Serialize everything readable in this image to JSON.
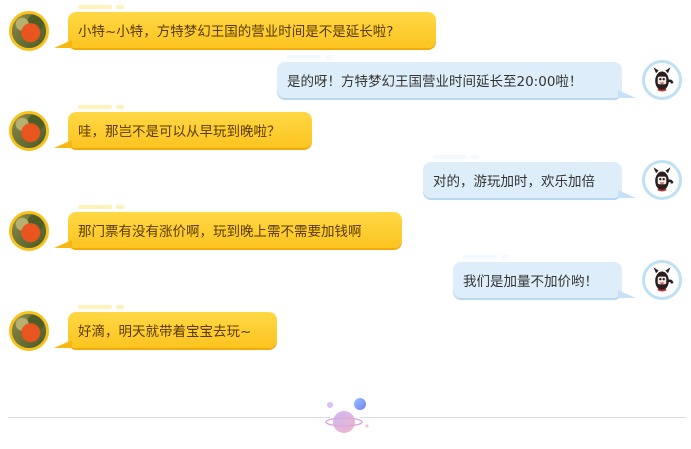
{
  "chat": {
    "messages": [
      {
        "side": "left",
        "text": "小特~小特，方特梦幻王国的营业时间是不是延长啦?"
      },
      {
        "side": "right",
        "text": "是的呀！方特梦幻王国营业时间延长至20:00啦！"
      },
      {
        "side": "left",
        "text": "哇，那岂不是可以从早玩到晚啦？"
      },
      {
        "side": "right",
        "text": "对的，游玩加时，欢乐加倍"
      },
      {
        "side": "left",
        "text": "那门票有没有涨价啊，玩到晚上需不需要加钱啊"
      },
      {
        "side": "right",
        "text": "我们是加量不加价哟！"
      },
      {
        "side": "left",
        "text": "好滴，明天就带着宝宝去玩~"
      }
    ]
  },
  "colors": {
    "left_bubble": "#fcc420",
    "right_bubble": "#ddeefa",
    "left_avatar_ring": "#f7c21b",
    "right_avatar_ring": "#bfe0f5"
  },
  "icons": {
    "left_avatar": "red-flower-photo-avatar",
    "right_avatar": "cartoon-mascot-avatar",
    "divider": "planet-icon"
  }
}
